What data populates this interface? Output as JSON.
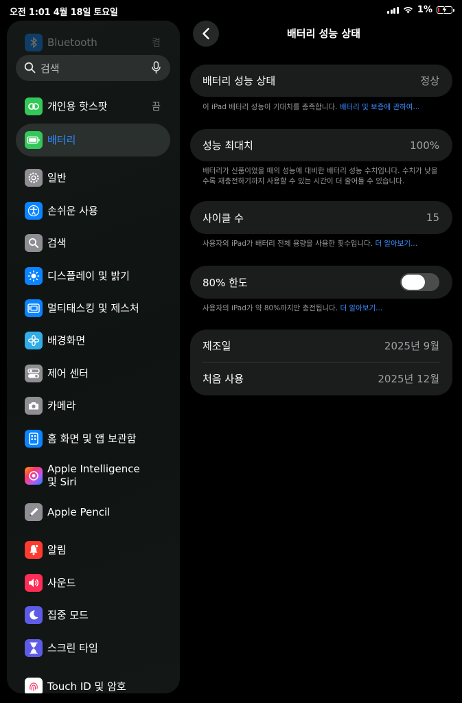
{
  "status_bar": {
    "time_date": "오전 1:01   4월 18일 토요일",
    "battery_percent": "1%"
  },
  "search": {
    "placeholder": "검색"
  },
  "sidebar": {
    "items": [
      {
        "label": "Bluetooth",
        "value": "켬",
        "icon": "bluetooth-icon",
        "color": "#0a84ff"
      },
      {
        "label": "개인용 핫스팟",
        "value": "끔",
        "icon": "hotspot-icon",
        "color": "#34c759"
      },
      {
        "label": "배터리",
        "value": "",
        "icon": "battery-icon",
        "color": "#34c759"
      },
      {
        "label": "일반",
        "value": "",
        "icon": "gear-icon",
        "color": "#8e8e93"
      },
      {
        "label": "손쉬운 사용",
        "value": "",
        "icon": "accessibility-icon",
        "color": "#0a84ff"
      },
      {
        "label": "검색",
        "value": "",
        "icon": "search-icon",
        "color": "#8e8e93"
      },
      {
        "label": "디스플레이 및 밝기",
        "value": "",
        "icon": "brightness-icon",
        "color": "#0a84ff"
      },
      {
        "label": "멀티태스킹 및 제스처",
        "value": "",
        "icon": "multitasking-icon",
        "color": "#0a84ff"
      },
      {
        "label": "배경화면",
        "value": "",
        "icon": "wallpaper-icon",
        "color": "#32ade6"
      },
      {
        "label": "제어 센터",
        "value": "",
        "icon": "control-center-icon",
        "color": "#8e8e93"
      },
      {
        "label": "카메라",
        "value": "",
        "icon": "camera-icon",
        "color": "#8e8e93"
      },
      {
        "label": "홈 화면 및 앱 보관함",
        "value": "",
        "icon": "home-screen-icon",
        "color": "#0a84ff"
      },
      {
        "label": "Apple Intelligence\n및 Siri",
        "value": "",
        "icon": "siri-icon",
        "color": "#bf5af2"
      },
      {
        "label": "Apple Pencil",
        "value": "",
        "icon": "pencil-icon",
        "color": "#8e8e93"
      },
      {
        "label": "알림",
        "value": "",
        "icon": "bell-icon",
        "color": "#ff3b30"
      },
      {
        "label": "사운드",
        "value": "",
        "icon": "speaker-icon",
        "color": "#ff2d55"
      },
      {
        "label": "집중 모드",
        "value": "",
        "icon": "moon-icon",
        "color": "#5e5ce6"
      },
      {
        "label": "스크린 타임",
        "value": "",
        "icon": "hourglass-icon",
        "color": "#5e5ce6"
      },
      {
        "label": "Touch ID 및 암호",
        "value": "",
        "icon": "fingerprint-icon",
        "color": "#ff375f"
      }
    ]
  },
  "page": {
    "title": "배터리 성능 상태",
    "health": {
      "label": "배터리 성능 상태",
      "value": "정상",
      "note": "이 iPad 배터리 성능이 기대치를 충족합니다.",
      "note_link": "배터리 및 보증에 관하여..."
    },
    "max_capacity": {
      "label": "성능 최대치",
      "value": "100%",
      "note": "배터리가 신품이었을 때의 성능에 대비한 배터리 성능 수치입니다. 수치가 낮을수록 재충전하기까지 사용할 수 있는 시간이 더 줄어들 수 있습니다."
    },
    "cycle_count": {
      "label": "사이클 수",
      "value": "15",
      "note": "사용자의 iPad가 배터리 전체 용량을 사용한 횟수입니다.",
      "note_link": "더 알아보기..."
    },
    "limit_80": {
      "label": "80% 한도",
      "enabled": false,
      "note": "사용자의 iPad가 약 80%까지만 충전됩니다.",
      "note_link": "더 알아보기..."
    },
    "dates": {
      "manufacture_label": "제조일",
      "manufacture_value": "2025년 9월",
      "first_use_label": "처음 사용",
      "first_use_value": "2025년 12월"
    }
  }
}
